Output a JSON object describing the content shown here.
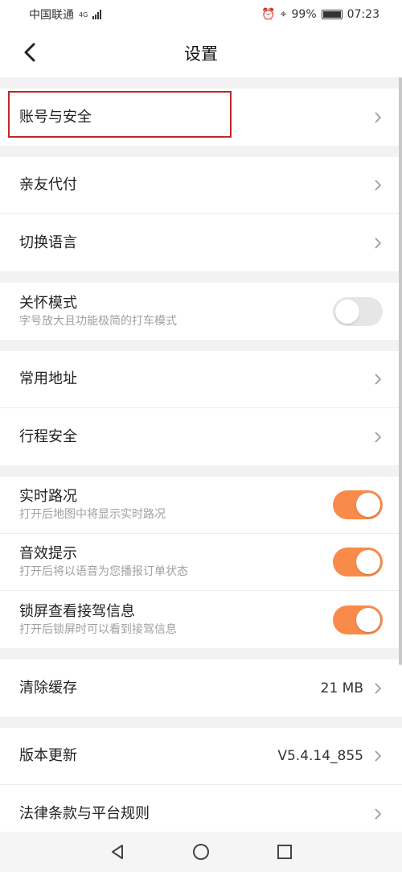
{
  "status_bar": {
    "carrier": "中国联通",
    "network": "4G",
    "battery": "99%",
    "time": "07:23"
  },
  "header": {
    "title": "设置"
  },
  "groups": {
    "account": {
      "label": "账号与安全"
    },
    "family_pay": {
      "label": "亲友代付"
    },
    "language": {
      "label": "切换语言"
    },
    "care_mode": {
      "label": "关怀模式",
      "subtitle": "字号放大且功能极简的打车模式",
      "enabled": false
    },
    "common_address": {
      "label": "常用地址"
    },
    "trip_safety": {
      "label": "行程安全"
    },
    "realtime_traffic": {
      "label": "实时路况",
      "subtitle": "打开后地图中将显示实时路况",
      "enabled": true
    },
    "sound_prompt": {
      "label": "音效提示",
      "subtitle": "打开后将以语音为您播报订单状态",
      "enabled": true
    },
    "lockscreen_info": {
      "label": "锁屏查看接驾信息",
      "subtitle": "打开后锁屏时可以看到接驾信息",
      "enabled": true
    },
    "clear_cache": {
      "label": "清除缓存",
      "value": "21 MB"
    },
    "version_update": {
      "label": "版本更新",
      "value": "V5.4.14_855"
    },
    "legal": {
      "label": "法律条款与平台规则"
    }
  },
  "colors": {
    "toggle_on": "#f98b4a",
    "toggle_off": "#e6e6e6",
    "highlight_border": "#c0272d",
    "background": "#f2f2f4"
  }
}
